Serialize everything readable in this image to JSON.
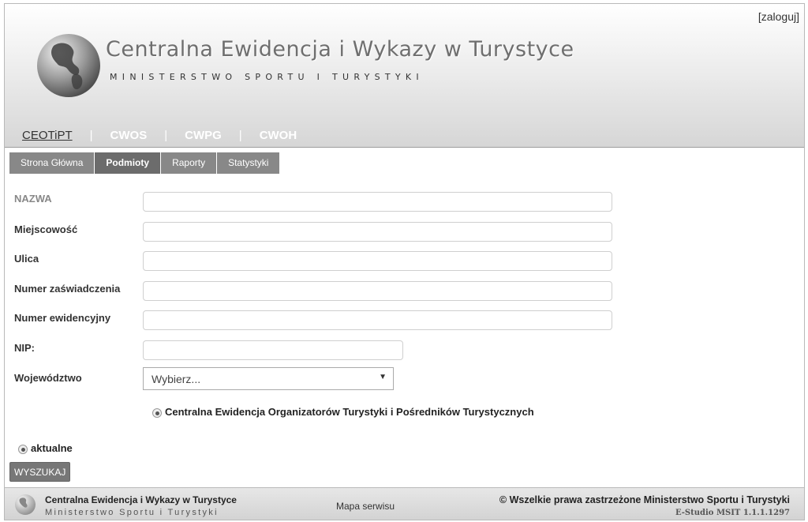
{
  "header": {
    "login_label": "[zaloguj]",
    "title": "Centralna Ewidencja i Wykazy w Turystyce",
    "subtitle": "MINISTERSTWO SPORTU I TURYSTYKI",
    "nav": [
      {
        "label": "CEOTiPT",
        "active": true
      },
      {
        "label": "CWOS"
      },
      {
        "label": "CWPG"
      },
      {
        "label": "CWOH"
      }
    ],
    "separator": "|"
  },
  "tabs": [
    {
      "label": "Strona Główna"
    },
    {
      "label": "Podmioty",
      "active": true
    },
    {
      "label": "Raporty"
    },
    {
      "label": "Statystyki"
    }
  ],
  "form": {
    "fields": {
      "nazwa": {
        "label": "NAZWA",
        "value": ""
      },
      "miejscowosc": {
        "label": "Miejscowość",
        "value": ""
      },
      "ulica": {
        "label": "Ulica",
        "value": ""
      },
      "numer_zaswiadczenia": {
        "label": "Numer zaświadczenia",
        "value": ""
      },
      "numer_ewidencyjny": {
        "label": "Numer ewidencyjny",
        "value": ""
      },
      "nip": {
        "label": "NIP:",
        "value": ""
      },
      "wojewodztwo": {
        "label": "Województwo",
        "selected": "Wybierz..."
      }
    },
    "registry_option": "Centralna Ewidencja Organizatorów Turystyki i Pośredników Turystycznych",
    "status_option": "aktualne",
    "search_button": "WYSZUKAJ"
  },
  "footer": {
    "title": "Centralna Ewidencja i Wykazy w Turystyce",
    "subtitle": "Ministerstwo Sportu i Turystyki",
    "site_map": "Mapa serwisu",
    "copyright": "© Wszelkie prawa zastrzeżone Ministerstwo Sportu i Turystyki",
    "version": "E-Studio MSIT 1.1.1.1297"
  }
}
